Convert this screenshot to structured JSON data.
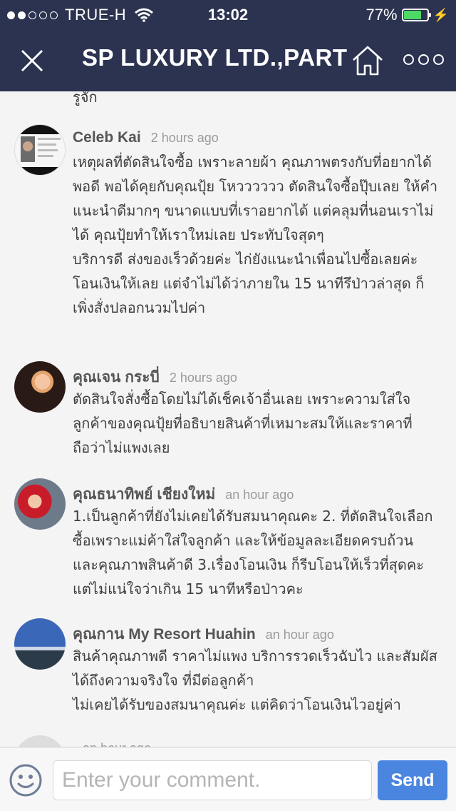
{
  "status_bar": {
    "carrier": "TRUE-H",
    "time": "13:02",
    "battery_percent": "77%",
    "battery_level": 0.77
  },
  "header": {
    "title": "SP LUXURY LTD.,PART",
    "close_icon": "close-icon",
    "home_icon": "home-icon",
    "more_icon": "more-icon"
  },
  "comments": {
    "partial_top_text": "รูจัก",
    "items": [
      {
        "name": "Celeb Kai",
        "time": "2 hours ago",
        "text": "เหตุผลที่ตัดสินใจซื้อ เพราะลายผ้า คุณภาพตรงกับที่อยากได้พอดี พอได้คุยกับคุณปุ้ย โหวววววว ตัดสินใจซื้อปุ๊บเลย ให้คำแนะนำดีมากๆ ขนาดแบบที่เราอยากได้ แต่คลุมที่นอนเราไม่ได้ คุณปุ้ยทำให้เราใหม่เลย ประทับใจสุดๆ\nบริการดี ส่งของเร็วด้วยค่ะ ไก่ยังแนะนำเพื่อนไปซื้อเลยค่ะ โอนเงินให้เลย แต่จำไม่ได้ว่าภายใน 15 นาทีรึป่าวล่าสุด ก็เพิ่งสั่งปลอกนวมไปค่า"
      },
      {
        "name": "คุณเจน กระบี่",
        "time": "2 hours ago",
        "text": "ตัดสินใจสั่งซื้อโดยไม่ได้เช็คเจ้าอื่นเลย เพราะความใส่ใจลูกค้าของคุณปุ้ยที่อธิบายสินค้าที่เหมาะสมให้และราคาที่ถือว่าไม่แพงเลย"
      },
      {
        "name": "คุณธนาทิพย์  เชียงใหม่",
        "time": "an hour ago",
        "text": "1.เป็นลูกค้าที่ยังไม่เคยได้รับสมนาคุณคะ 2. ที่ตัดสินใจเลือกซื้อเพราะแม่ค้าใส่ใจลูกค้า และให้ข้อมูลละเอียดครบถ้วน และคุณภาพสินค้าดี 3.เรื่องโอนเงิน ก็รีบโอนให้เร็วที่สุดคะ แต่ไม่แน่ใจว่าเกิน 15 นาทีหรือป่าวคะ"
      },
      {
        "name": "คุณกาน My Resort Huahin",
        "time": "an hour ago",
        "text": "สินค้าคุณภาพดี ราคาไม่แพง บริการรวดเร็วฉับไว และสัมผัสได้ถึงความจริงใจ ที่มีต่อลูกค้า\nไม่เคยได้รับของสมนาคุณค่ะ แต่คิดว่าโอนเงินไวอยู่ค่า"
      },
      {
        "name": "",
        "time": "an hour ago",
        "text": ""
      }
    ]
  },
  "input_bar": {
    "smiley_icon": "smiley-icon",
    "placeholder": "Enter your comment.",
    "send_label": "Send"
  }
}
